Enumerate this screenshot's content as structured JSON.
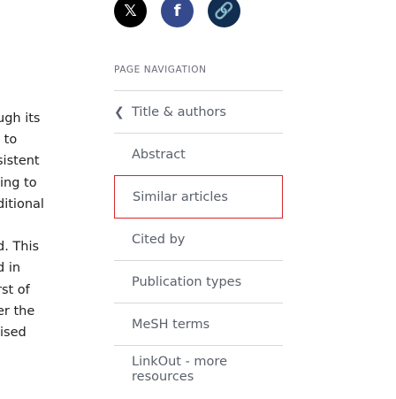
{
  "body_text": {
    "lines": [
      "ugh its",
      "l to",
      "sistent",
      "ling to",
      "ditional",
      "",
      "d. This",
      "d in",
      "rst of",
      "er the",
      "lised",
      "."
    ]
  },
  "share": {
    "icons": [
      "x-icon",
      "facebook-icon",
      "link-icon"
    ],
    "colors": [
      "#000000",
      "#344a8c",
      "#112e51"
    ]
  },
  "page_navigation": {
    "title": "PAGE NAVIGATION",
    "items": [
      {
        "label": "Title & authors"
      },
      {
        "label": "Abstract"
      },
      {
        "label": "Similar articles"
      },
      {
        "label": "Cited by"
      },
      {
        "label": "Publication types"
      },
      {
        "label": "MeSH terms"
      },
      {
        "label": "LinkOut - more resources"
      }
    ],
    "active_color": "#d9252a"
  }
}
